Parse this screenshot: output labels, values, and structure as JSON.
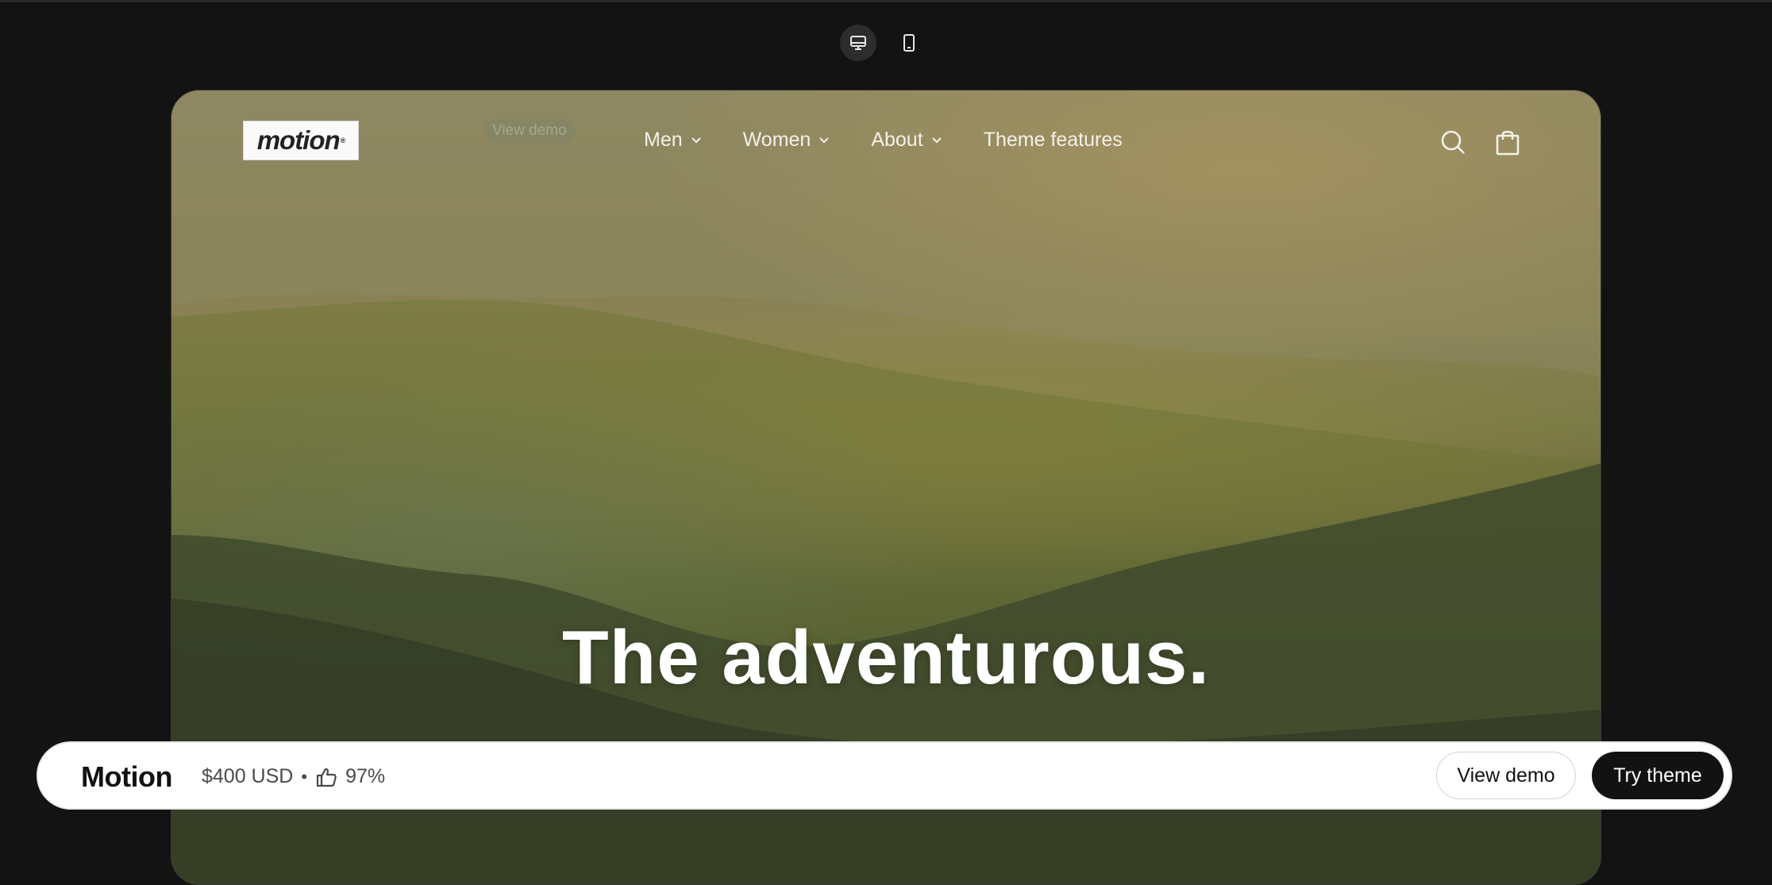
{
  "device_toggle": {
    "desktop_icon": "desktop-icon",
    "mobile_icon": "mobile-icon",
    "active": "desktop"
  },
  "store": {
    "logo_text": "motion",
    "logo_mark": "®",
    "ghost_button": "View demo",
    "nav": [
      {
        "label": "Men",
        "has_dropdown": true
      },
      {
        "label": "Women",
        "has_dropdown": true
      },
      {
        "label": "About",
        "has_dropdown": true
      },
      {
        "label": "Theme features",
        "has_dropdown": false
      }
    ],
    "icons": [
      "search-icon",
      "shopping-bag-icon"
    ],
    "hero_heading": "The adventurous."
  },
  "theme_bar": {
    "name": "Motion",
    "price": "$400 USD",
    "separator": "•",
    "rating": "97%",
    "rating_icon": "thumbs-up-icon",
    "view_demo_label": "View demo",
    "try_theme_label": "Try theme"
  },
  "colors": {
    "page_background": "#131313",
    "bar_background": "#ffffff",
    "primary_button": "#121212",
    "nav_text": "#f3f1ea"
  }
}
